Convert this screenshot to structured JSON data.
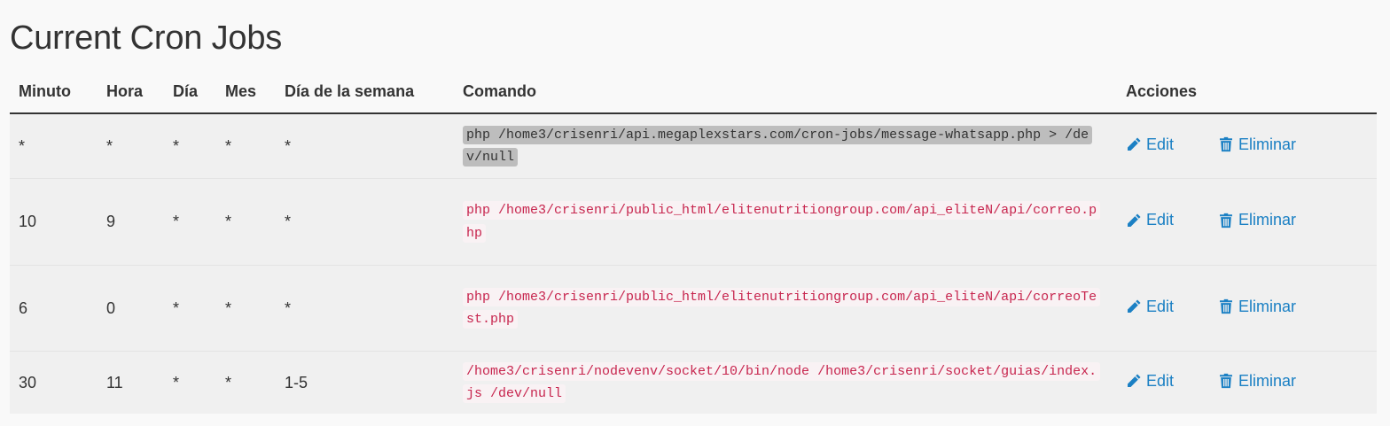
{
  "page": {
    "title": "Current Cron Jobs"
  },
  "table": {
    "headers": [
      "Minuto",
      "Hora",
      "Día",
      "Mes",
      "Día de la semana",
      "Comando",
      "Acciones"
    ],
    "rows": [
      {
        "minuto": "*",
        "hora": "*",
        "dia": "*",
        "mes": "*",
        "dia_semana": "*",
        "comando": "php /home3/crisenri/api.megaplexstars.com/cron-jobs/message-whatsapp.php > /dev/null",
        "edit": "Edit",
        "delete": "Eliminar"
      },
      {
        "minuto": "10",
        "hora": "9",
        "dia": "*",
        "mes": "*",
        "dia_semana": "*",
        "comando": "php /home3/crisenri/public_html/elitenutritiongroup.com/api_eliteN/api/correo.php",
        "edit": "Edit",
        "delete": "Eliminar"
      },
      {
        "minuto": "6",
        "hora": "0",
        "dia": "*",
        "mes": "*",
        "dia_semana": "*",
        "comando": "php /home3/crisenri/public_html/elitenutritiongroup.com/api_eliteN/api/correoTest.php",
        "edit": "Edit",
        "delete": "Eliminar"
      },
      {
        "minuto": "30",
        "hora": "11",
        "dia": "*",
        "mes": "*",
        "dia_semana": "1-5",
        "comando": "/home3/crisenri/nodevenv/socket/10/bin/node /home3/crisenri/socket/guias/index.js /dev/null",
        "edit": "Edit",
        "delete": "Eliminar"
      }
    ]
  },
  "colors": {
    "link": "#1b80c4",
    "code_text": "#c7254e",
    "code_bg": "#f9f2f4",
    "selection_bg": "#bdbdbd"
  },
  "icons": {
    "edit": "pencil-icon",
    "delete": "trash-icon"
  }
}
